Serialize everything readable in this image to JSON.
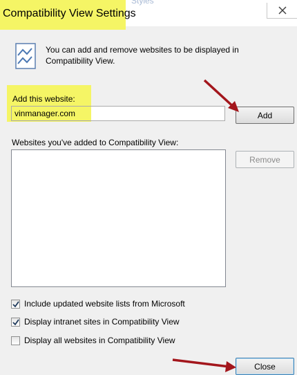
{
  "window": {
    "title": "Compatibility View Settings",
    "behind_text": "Styles",
    "highlight_color": "#f5f565"
  },
  "info": {
    "text": "You can add and remove websites to be displayed in Compatibility View.",
    "icon": "compatibility-view-icon"
  },
  "add_website": {
    "label": "Add this website:",
    "value": "vinmanager.com",
    "button_label": "Add"
  },
  "sites_list": {
    "label": "Websites you've added to Compatibility View:",
    "items": [],
    "remove_label": "Remove",
    "remove_enabled": false
  },
  "options": [
    {
      "label": "Include updated website lists from Microsoft",
      "checked": true
    },
    {
      "label": "Display intranet sites in Compatibility View",
      "checked": true
    },
    {
      "label": "Display all websites in Compatibility View",
      "checked": false
    }
  ],
  "footer": {
    "close_label": "Close"
  },
  "annotations": {
    "arrow_color": "#a3161c"
  }
}
